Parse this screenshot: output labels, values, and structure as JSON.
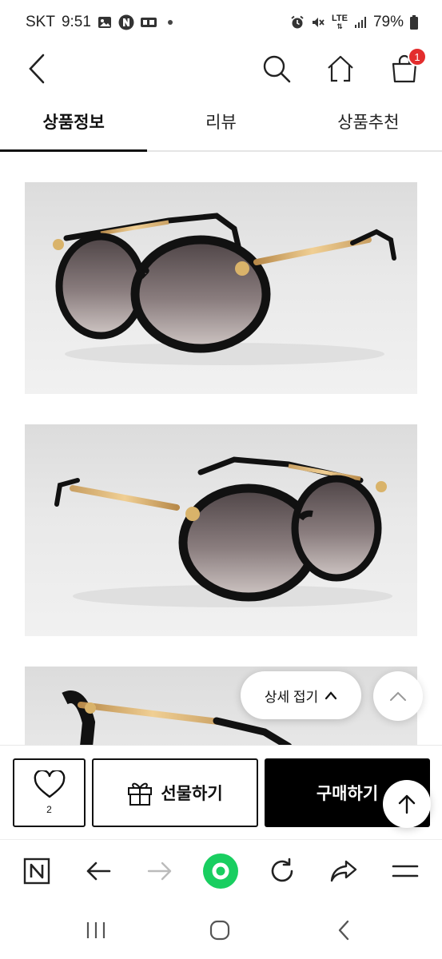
{
  "status_bar": {
    "carrier": "SKT",
    "time": "9:51",
    "network": "LTE",
    "battery": "79%",
    "notification_icons": [
      "image-icon",
      "naver-icon",
      "messages-icon"
    ],
    "system_icons": [
      "alarm-icon",
      "mute-icon",
      "signal-icon",
      "battery-icon"
    ]
  },
  "header": {
    "cart_count": "1",
    "icons": [
      "back-arrow-icon",
      "search-icon",
      "home-icon",
      "cart-icon"
    ]
  },
  "tabs": [
    {
      "label": "상품정보",
      "active": true
    },
    {
      "label": "리뷰",
      "active": false
    },
    {
      "label": "상품추천",
      "active": false
    }
  ],
  "product_images": [
    {
      "name": "product-image-1",
      "subject": "black sunglasses, gold temple, left view"
    },
    {
      "name": "product-image-2",
      "subject": "black sunglasses, gold temple, right view"
    },
    {
      "name": "product-image-3",
      "subject": "black sunglasses, side view"
    }
  ],
  "floating": {
    "collapse_label": "상세 접기"
  },
  "actions": {
    "like_count": "2",
    "gift_label": "선물하기",
    "buy_label": "구매하기"
  },
  "browser_toolbar": {
    "icons": [
      "naver-n-icon",
      "back-icon",
      "forward-icon",
      "green-home-icon",
      "refresh-icon",
      "share-icon",
      "menu-icon"
    ]
  },
  "nav_bar": {
    "icons": [
      "recents-icon",
      "home-circle-icon",
      "back-nav-icon"
    ]
  },
  "colors": {
    "accent_badge": "#e32d2d",
    "green_button": "#19ce60",
    "buy_button": "#000000"
  }
}
